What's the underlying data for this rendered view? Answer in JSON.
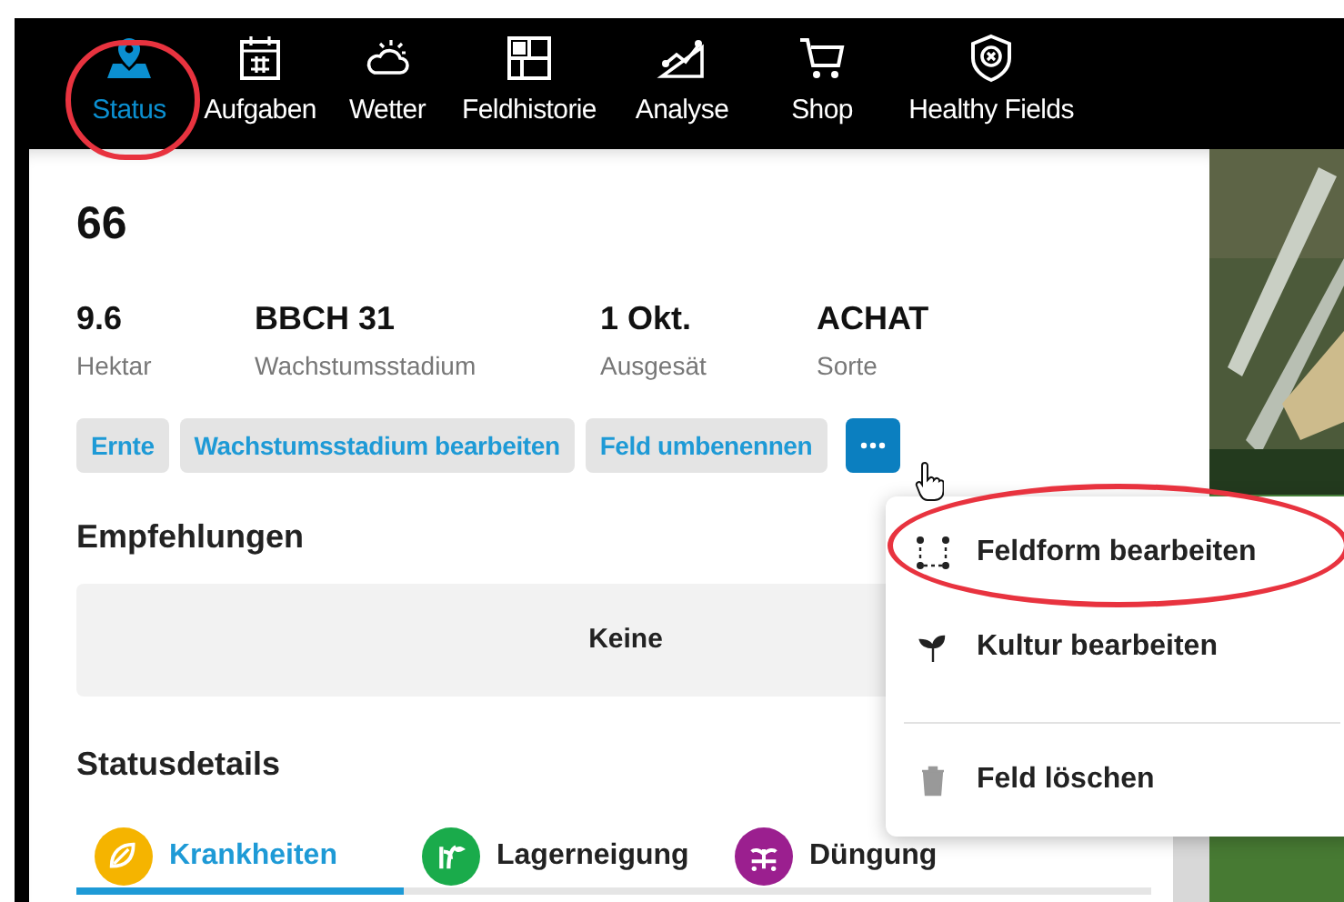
{
  "nav_items": [
    {
      "label": "Status",
      "kind": "pin",
      "selected": true
    },
    {
      "label": "Aufgaben",
      "kind": "calendar",
      "selected": false
    },
    {
      "label": "Wetter",
      "kind": "weather",
      "selected": false
    },
    {
      "label": "Feldhistorie",
      "kind": "layout",
      "selected": false
    },
    {
      "label": "Analyse",
      "kind": "analysis",
      "selected": false
    },
    {
      "label": "Shop",
      "kind": "cart",
      "selected": false
    },
    {
      "label": "Healthy Fields",
      "kind": "shield",
      "selected": false
    }
  ],
  "field": {
    "name": "66",
    "stats": [
      {
        "value": "9.6",
        "label": "Hektar"
      },
      {
        "value": "BBCH 31",
        "label": "Wachstumsstadium"
      },
      {
        "value": "1 Okt.",
        "label": "Ausgesät"
      },
      {
        "value": "ACHAT",
        "label": "Sorte"
      }
    ],
    "actions": [
      "Ernte",
      "Wachstumsstadium bearbeiten",
      "Feld umbenennen"
    ]
  },
  "recommendations": {
    "title": "Empfehlungen",
    "content": "Keine"
  },
  "status_details": {
    "title": "Statusdetails",
    "tabs": [
      {
        "label": "Krankheiten",
        "color": "#f5b400",
        "kind": "leaf",
        "selected": true
      },
      {
        "label": "Lagerneigung",
        "color": "#1aab4b",
        "kind": "stalk",
        "selected": false
      },
      {
        "label": "Düngung",
        "color": "#9b1f8f",
        "kind": "sprout",
        "selected": false
      }
    ]
  },
  "menu": {
    "items": [
      {
        "label": "Feldform bearbeiten",
        "kind": "shape"
      },
      {
        "label": "Kultur bearbeiten",
        "kind": "crop"
      },
      {
        "label": "Feld löschen",
        "kind": "delete"
      }
    ]
  }
}
